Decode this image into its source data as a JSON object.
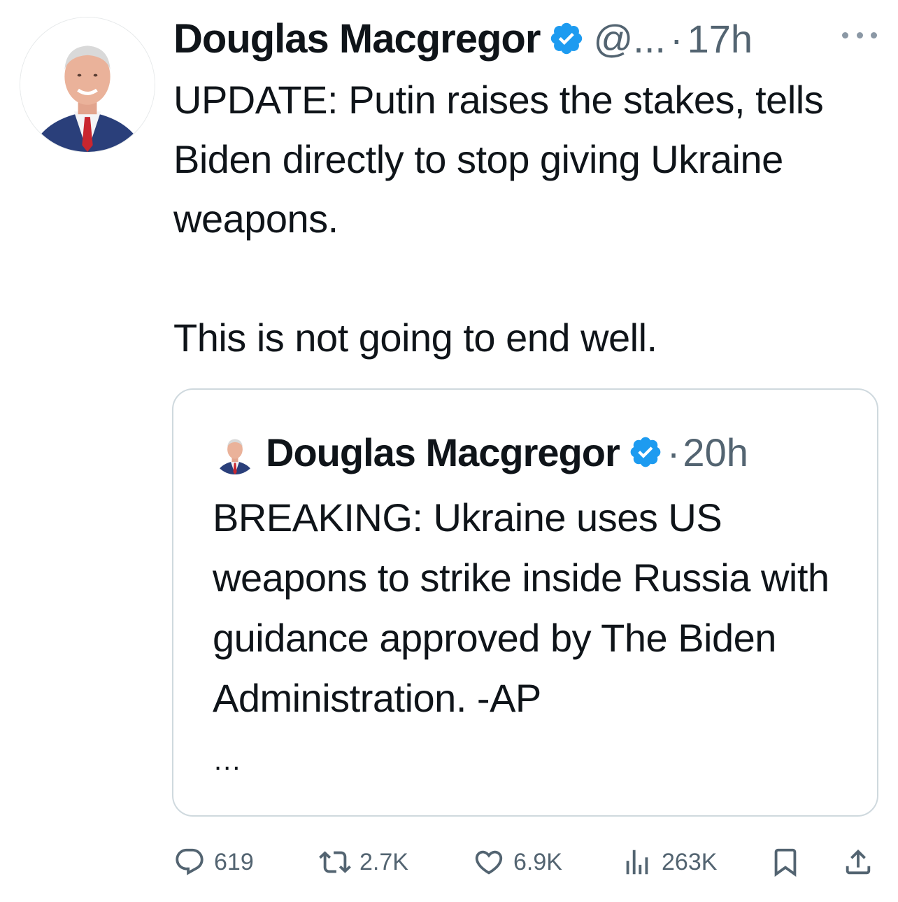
{
  "tweet": {
    "author": {
      "display_name": "Douglas Macgregor",
      "handle": "@...",
      "verified": true
    },
    "separator": "·",
    "time": "17h",
    "text_paragraphs": [
      "UPDATE: Putin raises the stakes, tells Biden directly to stop giving Ukraine weapons.",
      "This is not going to end well."
    ]
  },
  "quoted_tweet": {
    "author": {
      "display_name": "Douglas Macgregor",
      "verified": true
    },
    "separator": "·",
    "time": "20h",
    "text": "BREAKING: Ukraine uses US weapons to strike inside Russia with guidance approved by The Biden Administration. -AP",
    "truncation": "..."
  },
  "actions": {
    "replies": "619",
    "reposts": "2.7K",
    "likes": "6.9K",
    "views": "263K"
  },
  "colors": {
    "text_primary": "#0f1419",
    "text_secondary": "#536471",
    "verified_blue": "#1d9bf0",
    "border": "#cfd9de"
  },
  "icons": {
    "more": "more-horizontal-icon",
    "verified": "verified-badge-icon",
    "reply": "reply-icon",
    "repost": "repost-icon",
    "like": "heart-icon",
    "views": "views-icon",
    "bookmark": "bookmark-icon",
    "share": "share-icon"
  }
}
